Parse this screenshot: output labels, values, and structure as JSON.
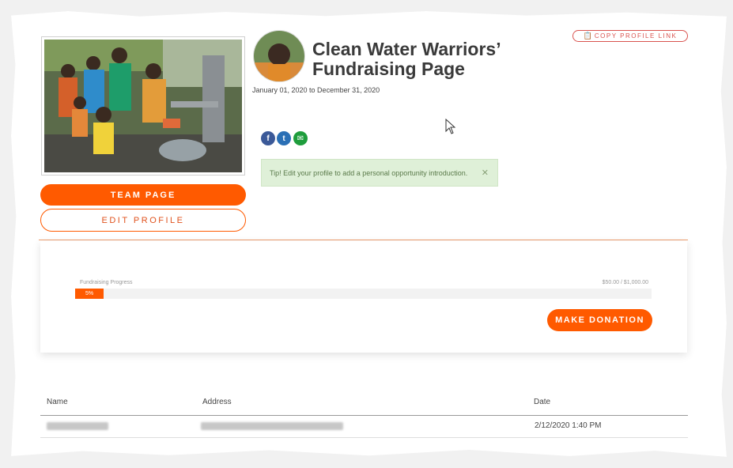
{
  "profile": {
    "title": "Clean Water Warriors’ Fundraising Page",
    "date_range": "January 01, 2020 to December 31, 2020",
    "copy_link_label": "COPY PROFILE LINK",
    "copy_icon": "clipboard-icon"
  },
  "buttons": {
    "team_page": "TEAM PAGE",
    "edit_profile": "EDIT PROFILE",
    "make_donation": "MAKE DONATION"
  },
  "social": [
    {
      "icon": "facebook-icon",
      "glyph": "f"
    },
    {
      "icon": "twitter-icon",
      "glyph": "t"
    },
    {
      "icon": "email-icon",
      "glyph": "✉"
    }
  ],
  "tip": {
    "text": "Tip! Edit your profile to add a personal opportunity introduction.",
    "close_glyph": "✕"
  },
  "progress": {
    "label": "Fundraising Progress",
    "amount_text": "$50.00 / $1,000.00",
    "percent_text": "5%",
    "fraction": 0.05
  },
  "table": {
    "headers": {
      "name": "Name",
      "address": "Address",
      "date": "Date"
    },
    "rows": [
      {
        "date": "2/12/2020 1:40 PM"
      }
    ]
  },
  "colors": {
    "accent": "#ff5a00",
    "tip_bg": "#dff0d8",
    "facebook": "#3b5998",
    "twitter": "#2a6fb5",
    "email": "#1e9d3c"
  }
}
